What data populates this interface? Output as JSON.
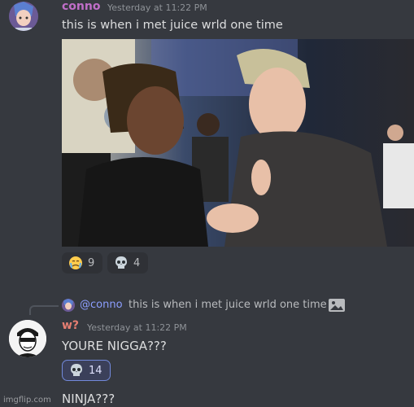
{
  "messages": [
    {
      "author": "conno",
      "timestamp": "Yesterday at 11:22 PM",
      "content": "this is when i met juice wrld one time",
      "reactions": [
        {
          "emoji_icon": "crying-face-icon",
          "count": "9"
        },
        {
          "emoji_icon": "skull-icon",
          "count": "4"
        }
      ]
    },
    {
      "reply_to": {
        "mention": "@conno",
        "content": "this is when i met juice wrld one time",
        "attachment_icon": "image-icon"
      },
      "author": "w?",
      "timestamp": "Yesterday at 11:22 PM",
      "content": "YOURE NIGGA???",
      "reactions": [
        {
          "emoji_icon": "skull-icon",
          "count": "14",
          "reacted": true
        }
      ],
      "followup": "NINJA???"
    }
  ],
  "watermark": "imgflip.com",
  "colors": {
    "background": "#36393f",
    "author1": "#c06ec8",
    "author2": "#e67e72",
    "mention": "#8c9eff",
    "reaction_active_border": "#7289da"
  }
}
